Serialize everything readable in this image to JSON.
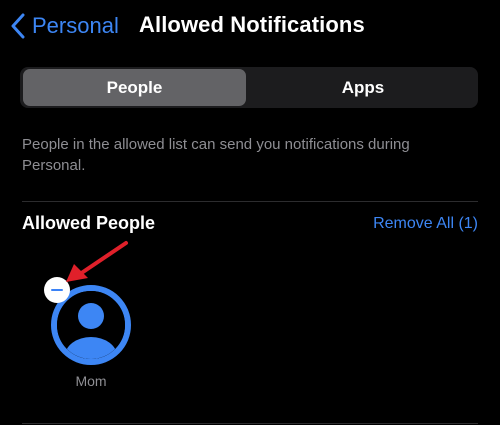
{
  "nav": {
    "back_label": "Personal",
    "title": "Allowed Notifications"
  },
  "segments": {
    "people": "People",
    "apps": "Apps",
    "selected": "People"
  },
  "description": "People in the allowed list can send you notifications during Personal.",
  "allowed_people": {
    "title": "Allowed People",
    "remove_all_label": "Remove All (1)",
    "contacts": [
      {
        "name": "Mom"
      }
    ]
  },
  "colors": {
    "accent": "#3d86f4",
    "background": "#000000",
    "segment_bg": "#1c1c1e",
    "segment_selected": "#636366",
    "secondary_text": "#8e8e93",
    "annotation_arrow": "#e0202a"
  }
}
